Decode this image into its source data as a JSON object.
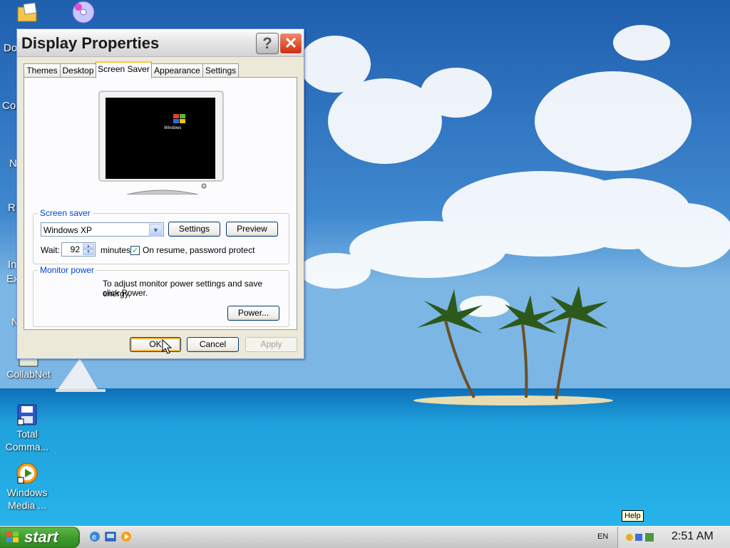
{
  "desktop": {
    "icons": [
      {
        "label_1": "CollabNet",
        "label_2": ""
      },
      {
        "label_1": "Total",
        "label_2": "Comma..."
      },
      {
        "label_1": "Windows",
        "label_2": "Media ..."
      }
    ],
    "clipped_labels": [
      "Do",
      "Co",
      "N",
      "R",
      "In",
      "Ex",
      "N"
    ]
  },
  "window": {
    "title": "Display Properties",
    "help_label": "?",
    "close_label": "✕",
    "tabs": [
      {
        "label": "Themes"
      },
      {
        "label": "Desktop"
      },
      {
        "label": "Screen Saver",
        "active": true
      },
      {
        "label": "Appearance"
      },
      {
        "label": "Settings"
      }
    ],
    "preview": {
      "logo_text": "Windows"
    },
    "screen_saver": {
      "group_label": "Screen saver",
      "selected": "Windows XP",
      "settings_label": "Settings",
      "preview_label": "Preview",
      "wait_label": "Wait:",
      "wait_value": "92",
      "minutes_label": "minutes",
      "password_checked": true,
      "password_label": "On resume, password protect"
    },
    "monitor_power": {
      "group_label": "Monitor power",
      "text_1": "To adjust monitor power settings and save energy,",
      "text_2": "click Power.",
      "power_label": "Power..."
    },
    "buttons": {
      "ok": "OK",
      "cancel": "Cancel",
      "apply": "Apply"
    }
  },
  "taskbar": {
    "start_label": "start",
    "language": "EN",
    "clock": "2:51 AM",
    "tooltip": "Help"
  },
  "colors": {
    "accent": "#0046d5",
    "start_green": "#3f9c2d",
    "tab_highlight": "#ffc83c"
  }
}
